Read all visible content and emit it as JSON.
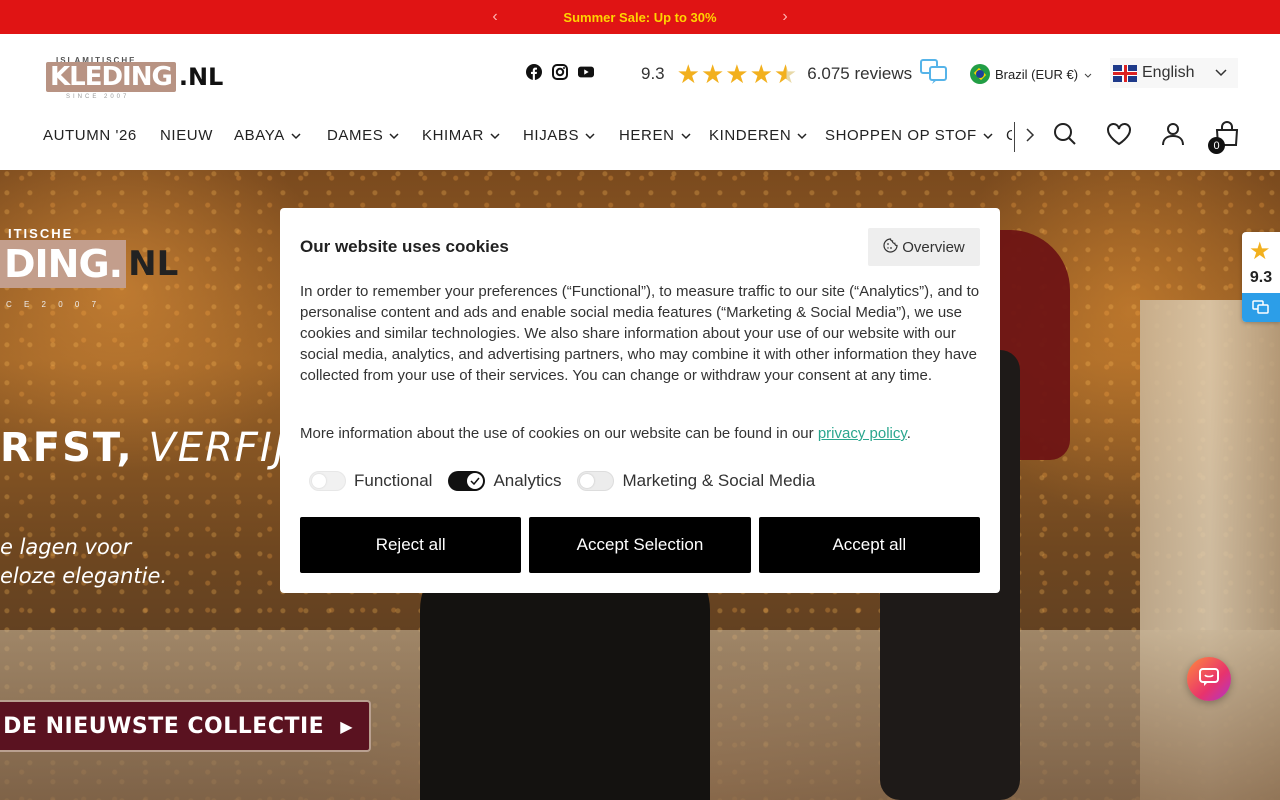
{
  "announcement": {
    "text": "Summer Sale: Up to 30%",
    "prev": "‹",
    "next": "›"
  },
  "brand": {
    "top": "ISLAMITISCHE",
    "main": "KLEDING",
    "suffix": ".NL",
    "since": "SINCE 2007"
  },
  "social": [
    "facebook-icon",
    "instagram-icon",
    "youtube-icon"
  ],
  "rating": {
    "score": "9.3",
    "stars": 4.5,
    "reviews": "6.075 reviews"
  },
  "country": {
    "label": "Brazil (EUR €)"
  },
  "language": {
    "label": "English"
  },
  "nav": [
    {
      "label": "AUTUMN '26",
      "dropdown": false
    },
    {
      "label": "NIEUW",
      "dropdown": false
    },
    {
      "label": "ABAYA",
      "dropdown": true
    },
    {
      "label": "DAMES",
      "dropdown": true
    },
    {
      "label": "KHIMAR",
      "dropdown": true
    },
    {
      "label": "HIJABS",
      "dropdown": true
    },
    {
      "label": "HEREN",
      "dropdown": true
    },
    {
      "label": "KINDEREN",
      "dropdown": true
    },
    {
      "label": "SHOPPEN OP STOF",
      "dropdown": true
    },
    {
      "label": "C",
      "dropdown": false
    }
  ],
  "cart": {
    "count": "0"
  },
  "hero": {
    "logo_top": "ITISCHE",
    "logo_main": "DING.",
    "logo_suffix": "NL",
    "logo_since": "C E   2 0 0 7",
    "title_bold": "RFST,",
    "title_italic": " VERFIJN",
    "subtitle_line1": "e lagen voor",
    "subtitle_line2": "eloze elegantie.",
    "cta": "P DE NIEUWSTE COLLECTIE"
  },
  "badge": {
    "score": "9.3"
  },
  "cookie": {
    "title": "Our website uses cookies",
    "overview": "Overview",
    "body": "In order to remember your preferences (“Functional”), to measure traffic to our site (“Analytics”), and to personalise content and ads and enable social media features (“Marketing & Social Media”), we use cookies and similar technologies. We also share information about your use of our website with our social media, analytics, and advertising partners, who may combine it with other information they have collected from your use of their services. You can change or withdraw your consent at any time.",
    "more_prefix": "More information about the use of cookies on our website can be found in our ",
    "more_link": "privacy policy",
    "more_suffix": ".",
    "toggles": [
      {
        "label": "Functional",
        "on": false
      },
      {
        "label": "Analytics",
        "on": true
      },
      {
        "label": "Marketing & Social Media",
        "on": false
      }
    ],
    "buttons": {
      "reject": "Reject all",
      "selection": "Accept Selection",
      "accept": "Accept all"
    }
  },
  "colors": {
    "announce_bg": "#e01414",
    "announce_text": "#ffd400",
    "star": "#f2b01e",
    "link": "#2aa68e",
    "cta_bg": "#5a1220"
  }
}
